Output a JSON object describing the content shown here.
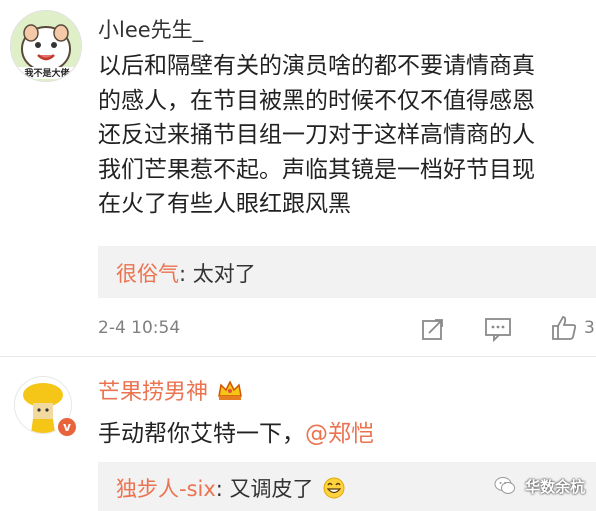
{
  "comment": {
    "username": "小lee先生_",
    "lines": [
      "以后和隔壁有关的演员啥的都不要请情商真",
      "的感人，在节目被黑的时候不仅不值得感恩",
      "还反过来捅节目组一刀对于这样高情商的人",
      "我们芒果惹不起。声临其镜是一档好节目现",
      "在火了有些人眼红跟风黑"
    ],
    "reply": {
      "user": "很俗气",
      "separator": ": ",
      "text": "太对了"
    },
    "timestamp": "2-4 10:54",
    "like_count": "3",
    "avatar_text": "我不是大佬"
  },
  "sub_comment": {
    "username": "芒果捞男神",
    "text": "手动帮你艾特一下，",
    "mention": "@郑恺",
    "reply": {
      "user": "独步人-six",
      "separator": ": ",
      "text": "又调皮了"
    },
    "verified_glyph": "v"
  },
  "watermark": {
    "text": "华数余杭"
  },
  "colors": {
    "accent": "#eb7350",
    "link": "#eb7350",
    "reply_bg": "#f2f2f2"
  }
}
